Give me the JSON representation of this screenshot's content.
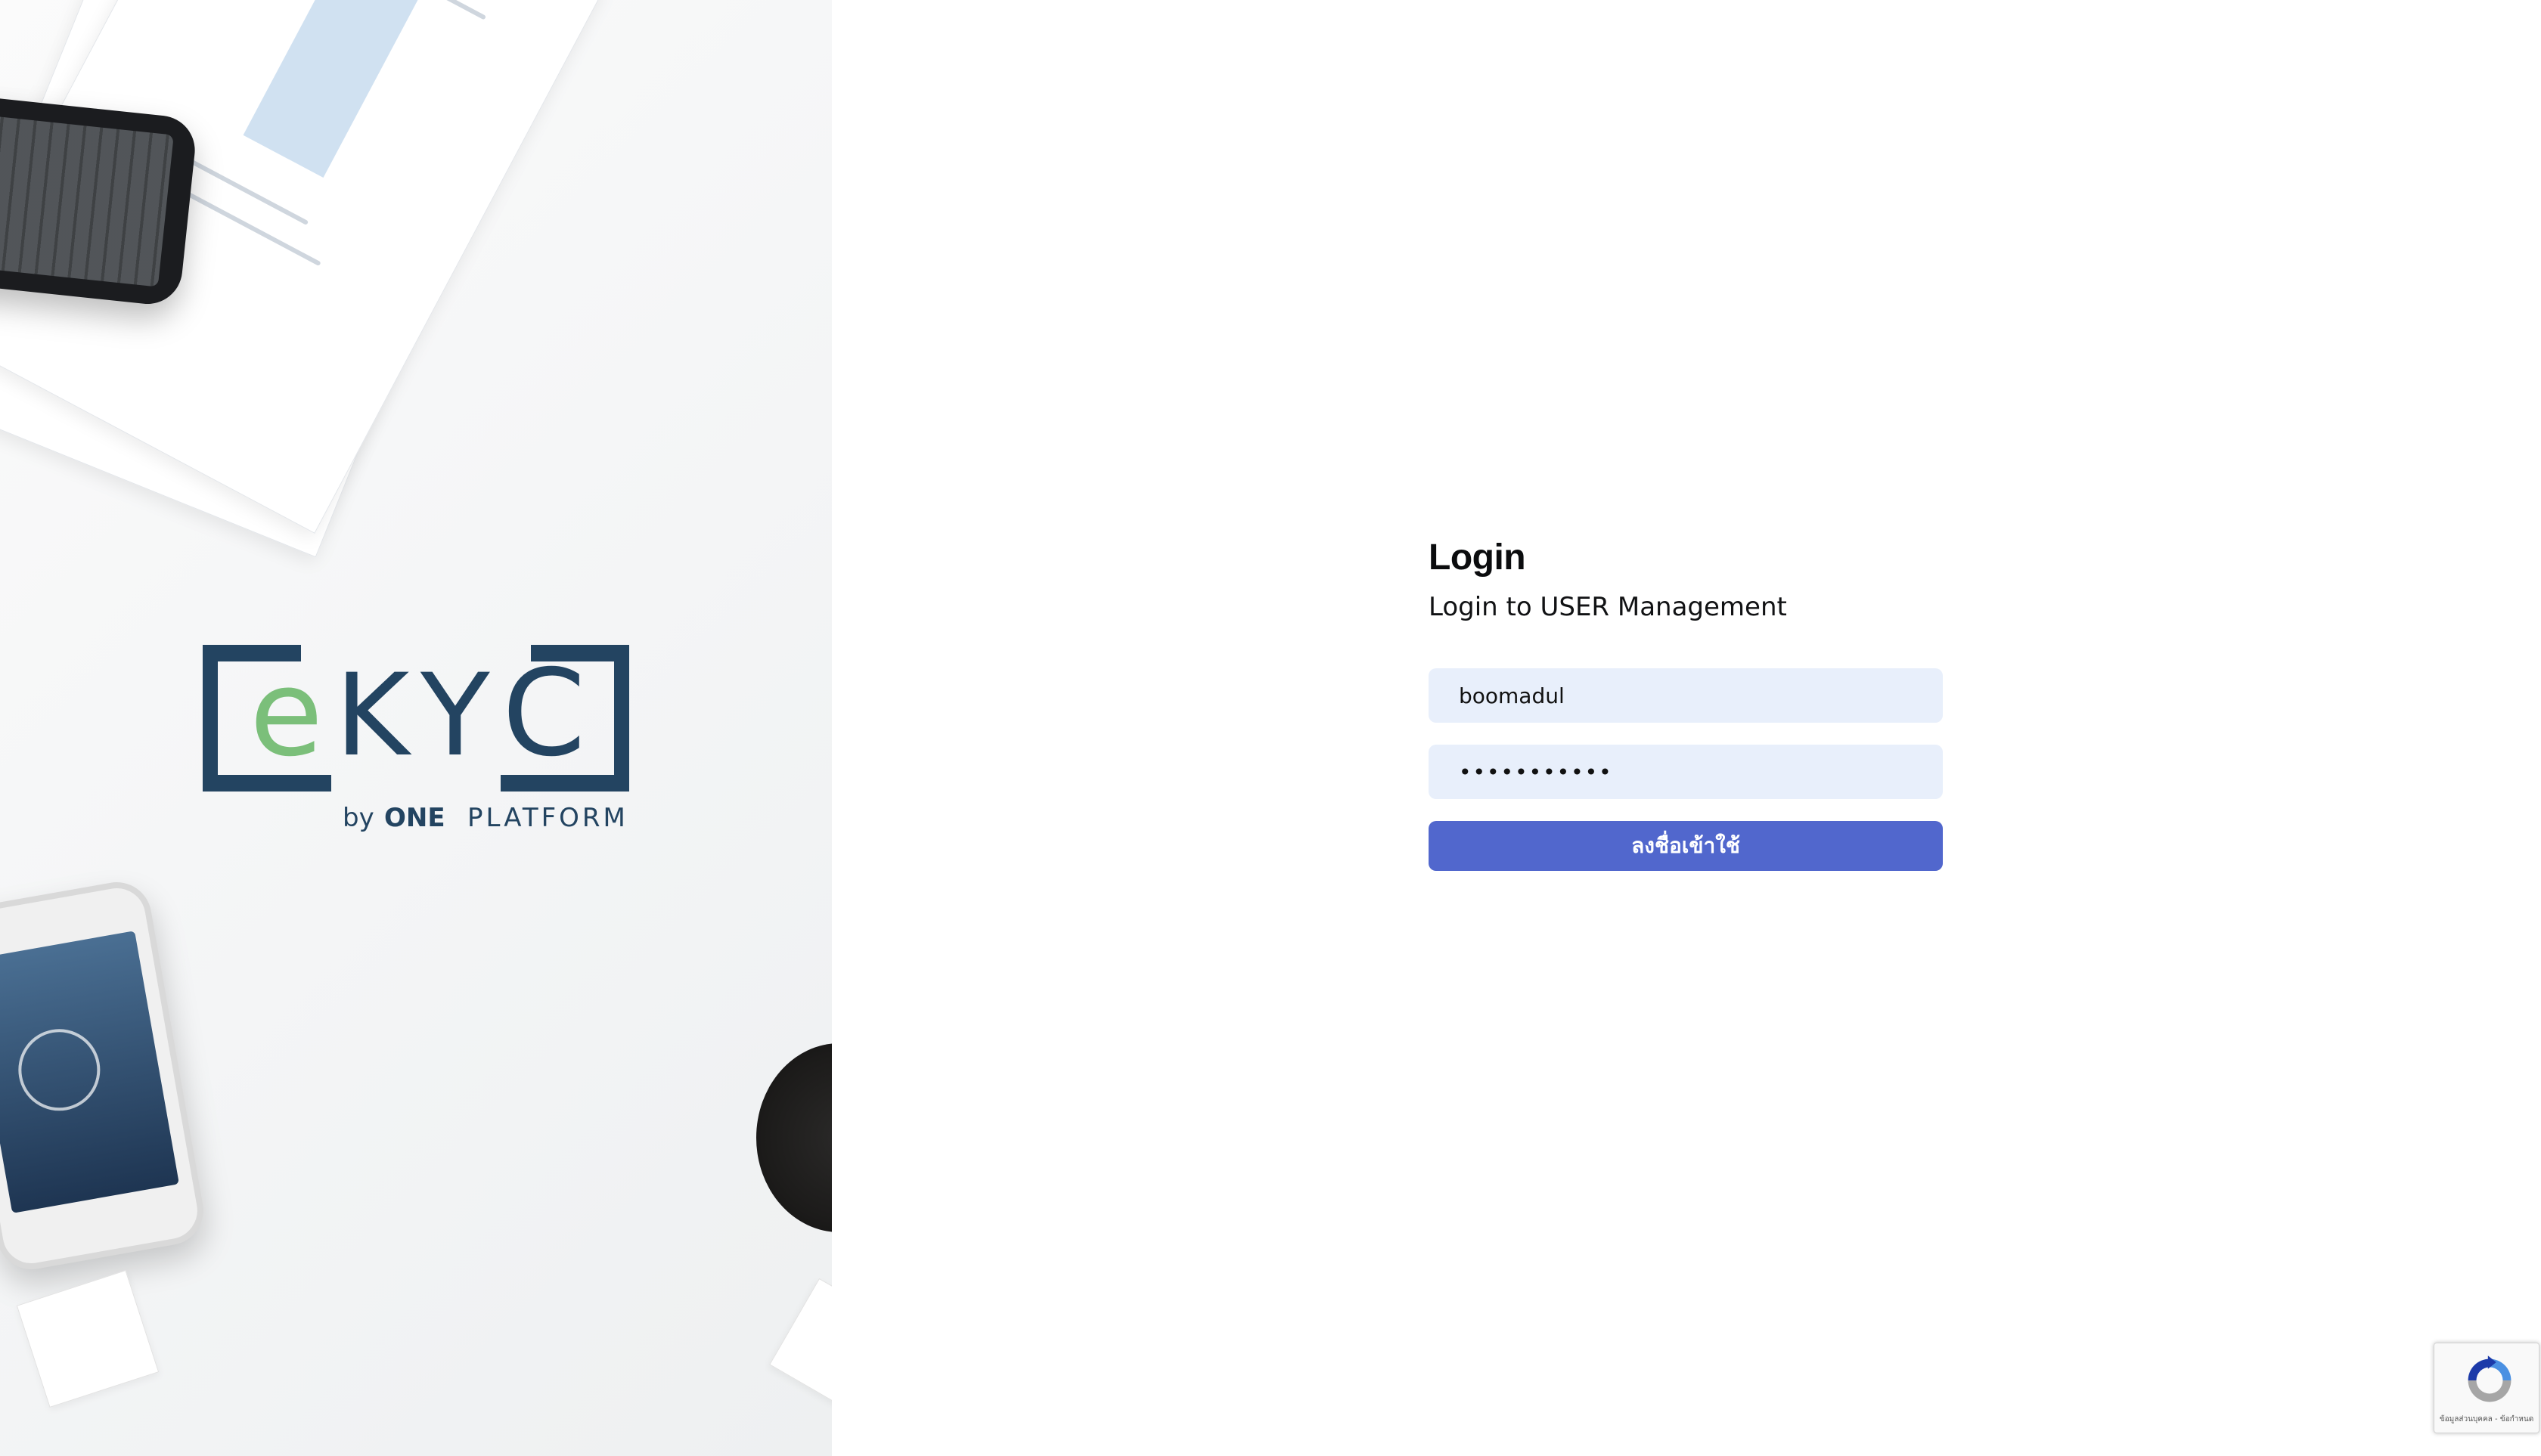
{
  "hero": {
    "logo_text": "eKYC",
    "logo_byline_prefix": "by",
    "logo_byline_brand": "ONE",
    "logo_byline_suffix": "PLATFORM",
    "colors": {
      "navy": "#234461",
      "green": "#7bbf7a"
    }
  },
  "login": {
    "title": "Login",
    "subtitle": "Login to USER Management",
    "username_value": "boomadul",
    "password_mask": "•••••••••••",
    "submit_label": "ลงชื่อเข้าใช้",
    "colors": {
      "field_bg": "#e8effb",
      "button_bg": "#5167cd"
    }
  },
  "recaptcha": {
    "footer_text": "ข้อมูลส่วนบุคคล - ข้อกำหนด",
    "icon": "recaptcha-icon"
  }
}
